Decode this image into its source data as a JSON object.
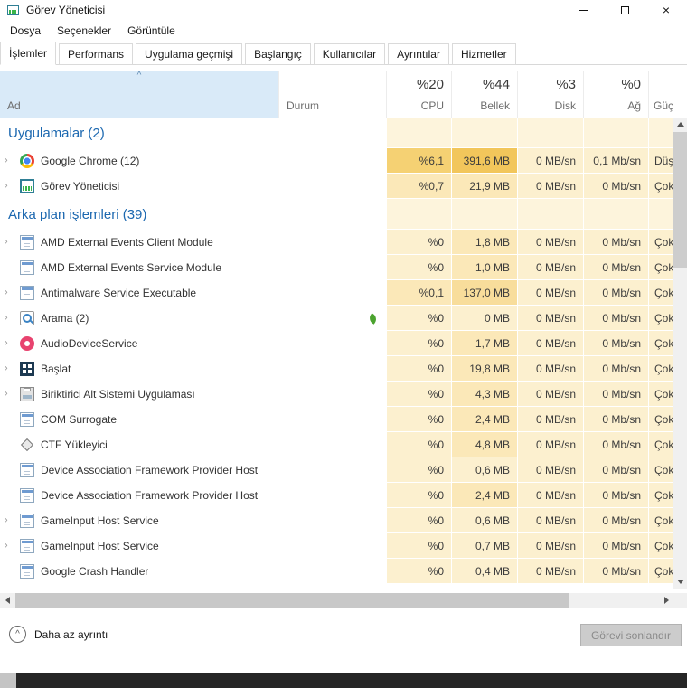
{
  "window": {
    "title": "Görev Yöneticisi"
  },
  "menu": {
    "items": [
      "Dosya",
      "Seçenekler",
      "Görüntüle"
    ]
  },
  "tabs": {
    "items": [
      {
        "label": "İşlemler",
        "active": true
      },
      {
        "label": "Performans",
        "active": false
      },
      {
        "label": "Uygulama geçmişi",
        "active": false
      },
      {
        "label": "Başlangıç",
        "active": false
      },
      {
        "label": "Kullanıcılar",
        "active": false
      },
      {
        "label": "Ayrıntılar",
        "active": false
      },
      {
        "label": "Hizmetler",
        "active": false
      }
    ]
  },
  "columns": {
    "name": {
      "label": "Ad"
    },
    "status": {
      "label": "Durum"
    },
    "cpu": {
      "value": "%20",
      "label": "CPU"
    },
    "mem": {
      "value": "%44",
      "label": "Bellek"
    },
    "disk": {
      "value": "%3",
      "label": "Disk"
    },
    "net": {
      "value": "%0",
      "label": "Ağ"
    },
    "power": {
      "label": "Güç kullanımı"
    }
  },
  "icons": {
    "sort_ascending": "^",
    "expand_chevron": "›",
    "close": "×",
    "collapse_chevron": "^"
  },
  "heat_colors": {
    "0": "#fdf4dc",
    "1": "#fcf0cf",
    "2": "#fbe8b8",
    "3": "#f8dd9b",
    "4": "#f5d173",
    "5": "#f2c65b"
  },
  "colors": {
    "group_text": "#1c68b0",
    "sorted_column_header_bg": "#d9eaf8"
  },
  "processes": {
    "groups": [
      {
        "label": "Uygulamalar (2)",
        "heat": [
          0,
          0,
          0,
          0,
          0
        ],
        "rows": [
          {
            "name": "Google Chrome (12)",
            "icon": "chrome",
            "expandable": true,
            "suspended": false,
            "cpu": "%6,1",
            "mem": "391,6 MB",
            "disk": "0 MB/sn",
            "net": "0,1 Mb/sn",
            "power": "Düşük",
            "heat": [
              4,
              5,
              1,
              1,
              1
            ]
          },
          {
            "name": "Görev Yöneticisi",
            "icon": "taskmgr",
            "expandable": true,
            "suspended": false,
            "cpu": "%0,7",
            "mem": "21,9 MB",
            "disk": "0 MB/sn",
            "net": "0 Mb/sn",
            "power": "Çok düşük",
            "heat": [
              2,
              2,
              1,
              1,
              1
            ]
          }
        ]
      },
      {
        "label": "Arka plan işlemleri (39)",
        "heat": [
          0,
          0,
          0,
          0,
          0
        ],
        "rows": [
          {
            "name": "AMD External Events Client Module",
            "icon": "window",
            "expandable": true,
            "suspended": false,
            "cpu": "%0",
            "mem": "1,8 MB",
            "disk": "0 MB/sn",
            "net": "0 Mb/sn",
            "power": "Çok düşük",
            "heat": [
              1,
              2,
              1,
              1,
              1
            ]
          },
          {
            "name": "AMD External Events Service Module",
            "icon": "window",
            "expandable": false,
            "suspended": false,
            "cpu": "%0",
            "mem": "1,0 MB",
            "disk": "0 MB/sn",
            "net": "0 Mb/sn",
            "power": "Çok düşük",
            "heat": [
              1,
              2,
              1,
              1,
              1
            ]
          },
          {
            "name": "Antimalware Service Executable",
            "icon": "window",
            "expandable": true,
            "suspended": false,
            "cpu": "%0,1",
            "mem": "137,0 MB",
            "disk": "0 MB/sn",
            "net": "0 Mb/sn",
            "power": "Çok düşük",
            "heat": [
              2,
              3,
              1,
              1,
              1
            ]
          },
          {
            "name": "Arama (2)",
            "icon": "search",
            "expandable": true,
            "suspended": true,
            "cpu": "%0",
            "mem": "0 MB",
            "disk": "0 MB/sn",
            "net": "0 Mb/sn",
            "power": "Çok düşük",
            "heat": [
              1,
              1,
              1,
              1,
              1
            ]
          },
          {
            "name": "AudioDeviceService",
            "icon": "audio",
            "expandable": true,
            "suspended": false,
            "cpu": "%0",
            "mem": "1,7 MB",
            "disk": "0 MB/sn",
            "net": "0 Mb/sn",
            "power": "Çok düşük",
            "heat": [
              1,
              2,
              1,
              1,
              1
            ]
          },
          {
            "name": "Başlat",
            "icon": "start",
            "expandable": true,
            "suspended": false,
            "cpu": "%0",
            "mem": "19,8 MB",
            "disk": "0 MB/sn",
            "net": "0 Mb/sn",
            "power": "Çok düşük",
            "heat": [
              1,
              2,
              1,
              1,
              1
            ]
          },
          {
            "name": "Biriktirici Alt Sistemi Uygulaması",
            "icon": "printer",
            "expandable": true,
            "suspended": false,
            "cpu": "%0",
            "mem": "4,3 MB",
            "disk": "0 MB/sn",
            "net": "0 Mb/sn",
            "power": "Çok düşük",
            "heat": [
              1,
              2,
              1,
              1,
              1
            ]
          },
          {
            "name": "COM Surrogate",
            "icon": "window",
            "expandable": false,
            "suspended": false,
            "cpu": "%0",
            "mem": "2,4 MB",
            "disk": "0 MB/sn",
            "net": "0 Mb/sn",
            "power": "Çok düşük",
            "heat": [
              1,
              2,
              1,
              1,
              1
            ]
          },
          {
            "name": "CTF Yükleyici",
            "icon": "diamond",
            "expandable": false,
            "suspended": false,
            "cpu": "%0",
            "mem": "4,8 MB",
            "disk": "0 MB/sn",
            "net": "0 Mb/sn",
            "power": "Çok düşük",
            "heat": [
              1,
              2,
              1,
              1,
              1
            ]
          },
          {
            "name": "Device Association Framework Provider Host",
            "icon": "window",
            "expandable": false,
            "suspended": false,
            "cpu": "%0",
            "mem": "0,6 MB",
            "disk": "0 MB/sn",
            "net": "0 Mb/sn",
            "power": "Çok düşük",
            "heat": [
              1,
              1,
              1,
              1,
              1
            ]
          },
          {
            "name": "Device Association Framework Provider Host",
            "icon": "window",
            "expandable": false,
            "suspended": false,
            "cpu": "%0",
            "mem": "2,4 MB",
            "disk": "0 MB/sn",
            "net": "0 Mb/sn",
            "power": "Çok düşük",
            "heat": [
              1,
              2,
              1,
              1,
              1
            ]
          },
          {
            "name": "GameInput Host Service",
            "icon": "window",
            "expandable": true,
            "suspended": false,
            "cpu": "%0",
            "mem": "0,6 MB",
            "disk": "0 MB/sn",
            "net": "0 Mb/sn",
            "power": "Çok düşük",
            "heat": [
              1,
              1,
              1,
              1,
              1
            ]
          },
          {
            "name": "GameInput Host Service",
            "icon": "window",
            "expandable": true,
            "suspended": false,
            "cpu": "%0",
            "mem": "0,7 MB",
            "disk": "0 MB/sn",
            "net": "0 Mb/sn",
            "power": "Çok düşük",
            "heat": [
              1,
              1,
              1,
              1,
              1
            ]
          },
          {
            "name": "Google Crash Handler",
            "icon": "window",
            "expandable": false,
            "suspended": false,
            "cpu": "%0",
            "mem": "0,4 MB",
            "disk": "0 MB/sn",
            "net": "0 Mb/sn",
            "power": "Çok düşük",
            "heat": [
              1,
              1,
              1,
              1,
              1
            ]
          }
        ]
      }
    ]
  },
  "status_bar": {
    "less_detail": "Daha az ayrıntı",
    "end_task": "Görevi sonlandır"
  }
}
